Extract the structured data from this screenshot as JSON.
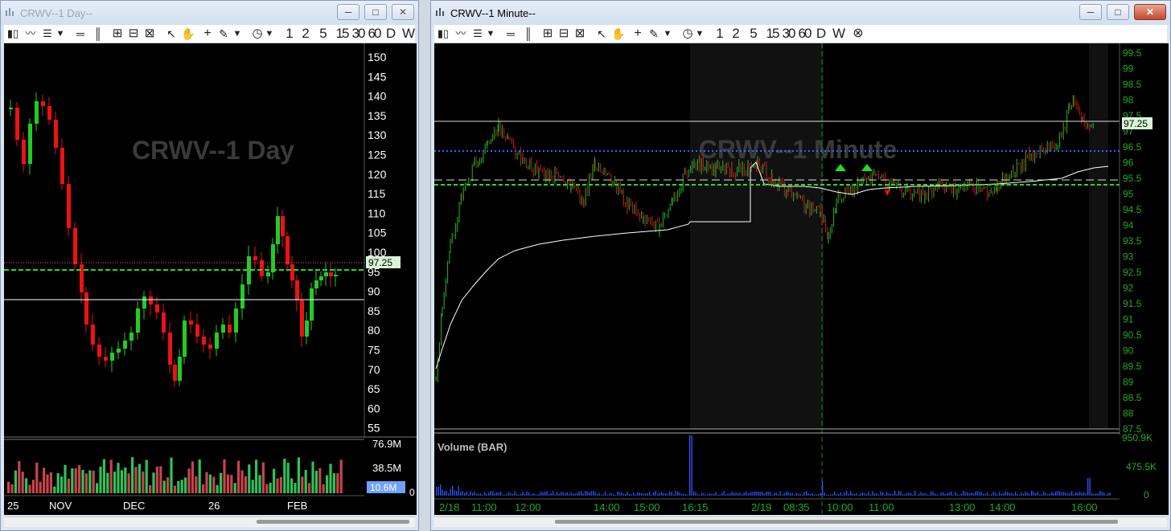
{
  "left_window": {
    "title": "CRWV--1 Day--",
    "watermark": "CRWV--1 Day",
    "price_label": "97.25",
    "price_axis": [
      "150",
      "145",
      "140",
      "135",
      "130",
      "125",
      "120",
      "115",
      "110",
      "105",
      "100",
      "95",
      "90",
      "85",
      "80",
      "75",
      "70",
      "65",
      "60",
      "55"
    ],
    "volume_axis": [
      "76.9M",
      "38.5M"
    ],
    "volume_current": "10.6M",
    "volume_zero": "0",
    "date_axis": [
      "25",
      "NOV",
      "DEC",
      "26",
      "FEB"
    ]
  },
  "right_window": {
    "title": "CRWV--1 Minute--",
    "watermark": "CRWV--1 Minute",
    "price_label": "97.25",
    "price_axis": [
      "99.5",
      "99",
      "98.5",
      "98",
      "97.5",
      "97",
      "96.5",
      "96",
      "95.5",
      "95",
      "94.5",
      "94",
      "93.5",
      "93",
      "92.5",
      "92",
      "91.5",
      "91",
      "90.5",
      "90",
      "89.5",
      "89",
      "88.5",
      "88",
      "87.5"
    ],
    "volume_title": "Volume (BAR)",
    "volume_axis": [
      "950.9K",
      "475.5K",
      "0"
    ],
    "time_axis": [
      "2/18",
      "11:00",
      "12:00",
      "14:00",
      "15:00",
      "16:15",
      "2/19",
      "08:35",
      "10:00",
      "11:00",
      "13:00",
      "14:00",
      "16:00"
    ]
  },
  "toolbar": {
    "intervals": [
      "1",
      "2",
      "5",
      "15",
      "30",
      "60",
      "D",
      "W"
    ]
  },
  "window_buttons": {
    "minimize": "─",
    "maximize": "□",
    "close": "✕"
  },
  "colors": {
    "up": "#22cc22",
    "down": "#ee1111",
    "price_label_bg": "#d8f5d8",
    "blue_dotted": "#2f66ff",
    "green_dashed": "#22dd22",
    "axis_green": "#22aa22"
  }
}
